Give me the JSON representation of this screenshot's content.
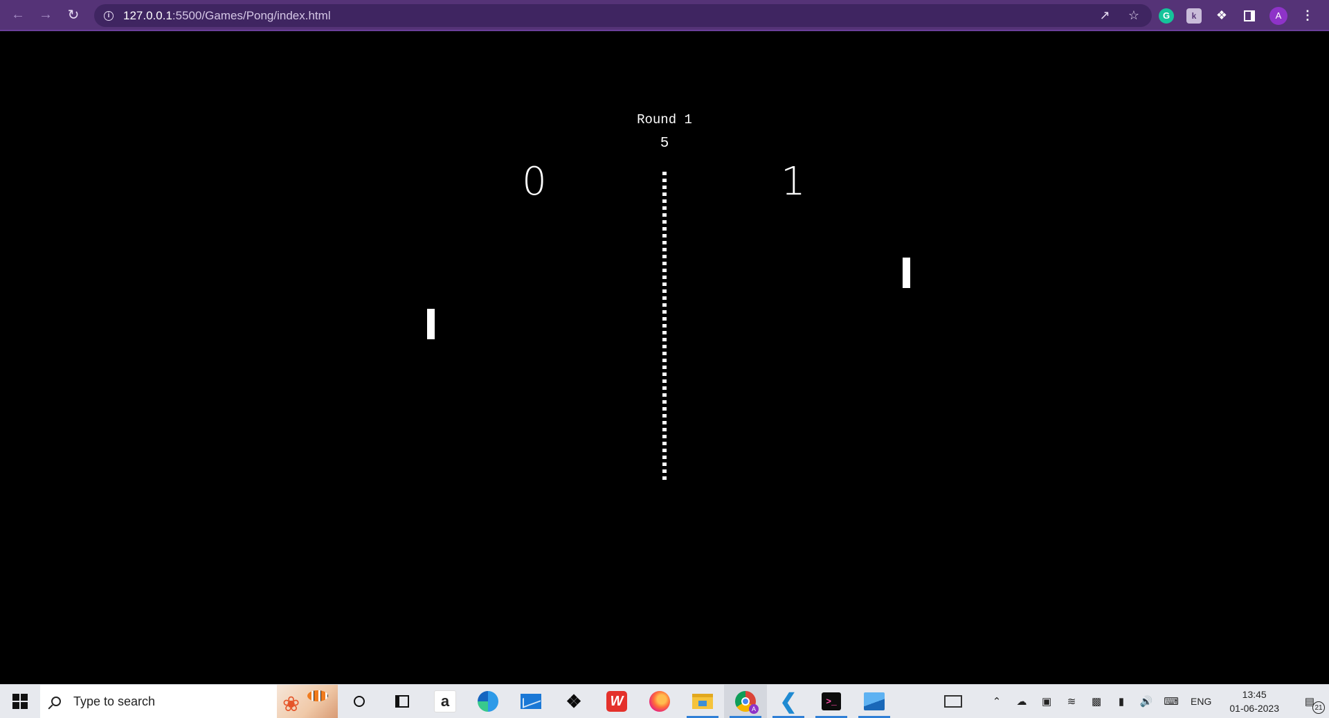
{
  "browser": {
    "url_host": "127.0.0.1",
    "url_path": ":5500/Games/Pong/index.html",
    "profile_initial": "A",
    "icons": [
      "back-icon",
      "forward-icon",
      "reload-icon",
      "info-icon",
      "share-icon",
      "star-icon",
      "grammarly-icon",
      "kami-icon",
      "extensions-icon",
      "side-panel-icon",
      "menu-icon"
    ],
    "theme_color": "#553377"
  },
  "game": {
    "round_label": "Round 1",
    "timer": "5",
    "left_score": "0",
    "right_score": "1",
    "background": "#000000",
    "foreground": "#ffffff"
  },
  "taskbar": {
    "search_placeholder": "Type to search",
    "amazon_glyph": "a",
    "wps_glyph": "W",
    "terminal_glyph": ">_",
    "chrome_badge": "A",
    "pinned_apps": [
      "cortana",
      "task-view",
      "amazon",
      "edge",
      "mail",
      "dropbox",
      "wps-office",
      "firefox",
      "file-explorer",
      "chrome",
      "vscode",
      "terminal",
      "photos"
    ],
    "tray": {
      "language": "ENG",
      "time": "13:45",
      "date": "01-06-2023",
      "notification_count": "21"
    }
  }
}
